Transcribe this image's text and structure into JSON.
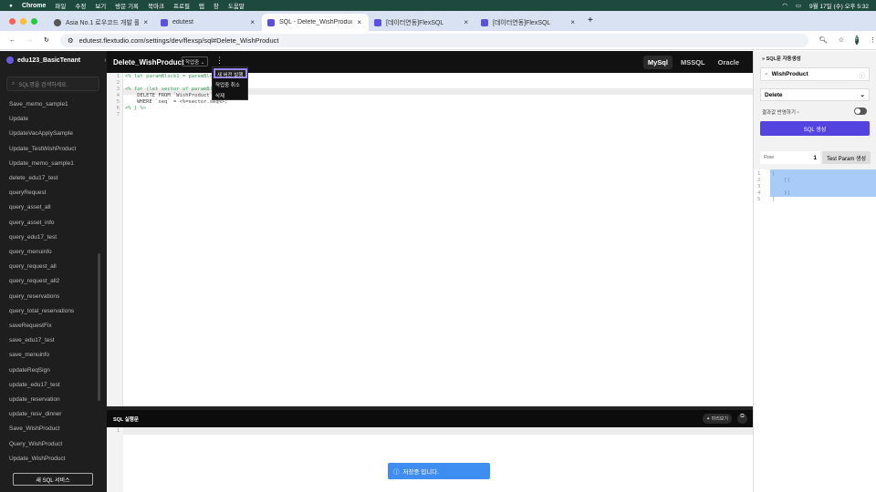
{
  "menubar": {
    "app": "Chrome",
    "items": [
      "파일",
      "수정",
      "보기",
      "방문 기록",
      "북마크",
      "프로필",
      "탭",
      "창",
      "도움말"
    ],
    "clock": "9월 17일 (수) 오후 5:32"
  },
  "tabs": [
    {
      "label": "Asia No.1 로우코드 개발 플랫폼",
      "active": false
    },
    {
      "label": "edutest",
      "active": false
    },
    {
      "label": "SQL - Delete_WishProduct",
      "active": true
    },
    {
      "label": "[데이터연동]FlexSQL",
      "active": false
    },
    {
      "label": "[데이터연동]FlexSQL",
      "active": false
    }
  ],
  "address": {
    "url": "edutest.flextudio.com/settings/dev/flexsp/sql#Delete_WishProduct",
    "profile": "F"
  },
  "sidebar": {
    "tenant": "edu123_BasicTenant",
    "search_placeholder": "SQL명을 검색하세요.",
    "items": [
      "Save_memo_sample1",
      "Update",
      "UpdateVacApplySample",
      "Update_TestWishProduct",
      "Update_memo_sample1",
      "delete_edu17_test",
      "queryRequest",
      "query_asset_all",
      "query_asset_info",
      "query_edu17_test",
      "query_menuinfo",
      "query_request_all",
      "query_request_all2",
      "query_reservations",
      "query_total_reservations",
      "saveRequestFix",
      "save_edu17_test",
      "save_menuinfo",
      "updateReqSign",
      "update_edu17_test",
      "update_reservation",
      "update_resv_dinner",
      "Save_WishProduct",
      "Query_WishProduct",
      "Update_WishProduct"
    ],
    "new_button": "새 SQL 서비스"
  },
  "editor": {
    "title": "Delete_WishProduct",
    "status": "작업중",
    "db_tabs": [
      "MySql",
      "MSSQL",
      "Oracle"
    ],
    "active_db": "MySql",
    "lines": [
      "<% let paramBlock1 = paramBlo",
      "",
      "<% for (let sector of paramBl",
      "    DELETE FROM `WishProduct`",
      "    WHERE `seq` = <%=sector.seq%>;",
      "<% } %>",
      ""
    ]
  },
  "context_menu": {
    "items": [
      "새 버전 발행",
      "작업중 취소",
      "삭제"
    ]
  },
  "bottom": {
    "title": "SQL 실행문",
    "preview": "미리보기",
    "lines": [
      "1"
    ]
  },
  "toast": {
    "text": "저장중 입니다."
  },
  "right": {
    "title": "SQL문 자동생성",
    "table": "WishProduct",
    "operation": "Delete",
    "reflect_label": "결과값 반영하기",
    "reflect_on": false,
    "generate": "SQL 생성",
    "row_label": "Row",
    "row_value": "1",
    "test_param": "Test Param 생성",
    "json_lines": [
      "[",
      "    [{",
      "",
      "    }]",
      "]"
    ]
  },
  "colors": {
    "accent": "#5344e0",
    "toast": "#3d8ef0",
    "menu_highlight": "#9b86ff"
  }
}
